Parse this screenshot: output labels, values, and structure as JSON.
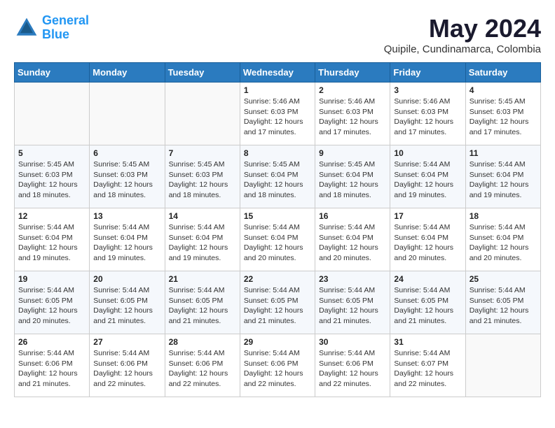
{
  "logo": {
    "line1": "General",
    "line2": "Blue"
  },
  "title": "May 2024",
  "location": "Quipile, Cundinamarca, Colombia",
  "headers": [
    "Sunday",
    "Monday",
    "Tuesday",
    "Wednesday",
    "Thursday",
    "Friday",
    "Saturday"
  ],
  "weeks": [
    [
      {
        "day": "",
        "info": ""
      },
      {
        "day": "",
        "info": ""
      },
      {
        "day": "",
        "info": ""
      },
      {
        "day": "1",
        "info": "Sunrise: 5:46 AM\nSunset: 6:03 PM\nDaylight: 12 hours\nand 17 minutes."
      },
      {
        "day": "2",
        "info": "Sunrise: 5:46 AM\nSunset: 6:03 PM\nDaylight: 12 hours\nand 17 minutes."
      },
      {
        "day": "3",
        "info": "Sunrise: 5:46 AM\nSunset: 6:03 PM\nDaylight: 12 hours\nand 17 minutes."
      },
      {
        "day": "4",
        "info": "Sunrise: 5:45 AM\nSunset: 6:03 PM\nDaylight: 12 hours\nand 17 minutes."
      }
    ],
    [
      {
        "day": "5",
        "info": "Sunrise: 5:45 AM\nSunset: 6:03 PM\nDaylight: 12 hours\nand 18 minutes."
      },
      {
        "day": "6",
        "info": "Sunrise: 5:45 AM\nSunset: 6:03 PM\nDaylight: 12 hours\nand 18 minutes."
      },
      {
        "day": "7",
        "info": "Sunrise: 5:45 AM\nSunset: 6:03 PM\nDaylight: 12 hours\nand 18 minutes."
      },
      {
        "day": "8",
        "info": "Sunrise: 5:45 AM\nSunset: 6:04 PM\nDaylight: 12 hours\nand 18 minutes."
      },
      {
        "day": "9",
        "info": "Sunrise: 5:45 AM\nSunset: 6:04 PM\nDaylight: 12 hours\nand 18 minutes."
      },
      {
        "day": "10",
        "info": "Sunrise: 5:44 AM\nSunset: 6:04 PM\nDaylight: 12 hours\nand 19 minutes."
      },
      {
        "day": "11",
        "info": "Sunrise: 5:44 AM\nSunset: 6:04 PM\nDaylight: 12 hours\nand 19 minutes."
      }
    ],
    [
      {
        "day": "12",
        "info": "Sunrise: 5:44 AM\nSunset: 6:04 PM\nDaylight: 12 hours\nand 19 minutes."
      },
      {
        "day": "13",
        "info": "Sunrise: 5:44 AM\nSunset: 6:04 PM\nDaylight: 12 hours\nand 19 minutes."
      },
      {
        "day": "14",
        "info": "Sunrise: 5:44 AM\nSunset: 6:04 PM\nDaylight: 12 hours\nand 19 minutes."
      },
      {
        "day": "15",
        "info": "Sunrise: 5:44 AM\nSunset: 6:04 PM\nDaylight: 12 hours\nand 20 minutes."
      },
      {
        "day": "16",
        "info": "Sunrise: 5:44 AM\nSunset: 6:04 PM\nDaylight: 12 hours\nand 20 minutes."
      },
      {
        "day": "17",
        "info": "Sunrise: 5:44 AM\nSunset: 6:04 PM\nDaylight: 12 hours\nand 20 minutes."
      },
      {
        "day": "18",
        "info": "Sunrise: 5:44 AM\nSunset: 6:04 PM\nDaylight: 12 hours\nand 20 minutes."
      }
    ],
    [
      {
        "day": "19",
        "info": "Sunrise: 5:44 AM\nSunset: 6:05 PM\nDaylight: 12 hours\nand 20 minutes."
      },
      {
        "day": "20",
        "info": "Sunrise: 5:44 AM\nSunset: 6:05 PM\nDaylight: 12 hours\nand 21 minutes."
      },
      {
        "day": "21",
        "info": "Sunrise: 5:44 AM\nSunset: 6:05 PM\nDaylight: 12 hours\nand 21 minutes."
      },
      {
        "day": "22",
        "info": "Sunrise: 5:44 AM\nSunset: 6:05 PM\nDaylight: 12 hours\nand 21 minutes."
      },
      {
        "day": "23",
        "info": "Sunrise: 5:44 AM\nSunset: 6:05 PM\nDaylight: 12 hours\nand 21 minutes."
      },
      {
        "day": "24",
        "info": "Sunrise: 5:44 AM\nSunset: 6:05 PM\nDaylight: 12 hours\nand 21 minutes."
      },
      {
        "day": "25",
        "info": "Sunrise: 5:44 AM\nSunset: 6:05 PM\nDaylight: 12 hours\nand 21 minutes."
      }
    ],
    [
      {
        "day": "26",
        "info": "Sunrise: 5:44 AM\nSunset: 6:06 PM\nDaylight: 12 hours\nand 21 minutes."
      },
      {
        "day": "27",
        "info": "Sunrise: 5:44 AM\nSunset: 6:06 PM\nDaylight: 12 hours\nand 22 minutes."
      },
      {
        "day": "28",
        "info": "Sunrise: 5:44 AM\nSunset: 6:06 PM\nDaylight: 12 hours\nand 22 minutes."
      },
      {
        "day": "29",
        "info": "Sunrise: 5:44 AM\nSunset: 6:06 PM\nDaylight: 12 hours\nand 22 minutes."
      },
      {
        "day": "30",
        "info": "Sunrise: 5:44 AM\nSunset: 6:06 PM\nDaylight: 12 hours\nand 22 minutes."
      },
      {
        "day": "31",
        "info": "Sunrise: 5:44 AM\nSunset: 6:07 PM\nDaylight: 12 hours\nand 22 minutes."
      },
      {
        "day": "",
        "info": ""
      }
    ]
  ]
}
